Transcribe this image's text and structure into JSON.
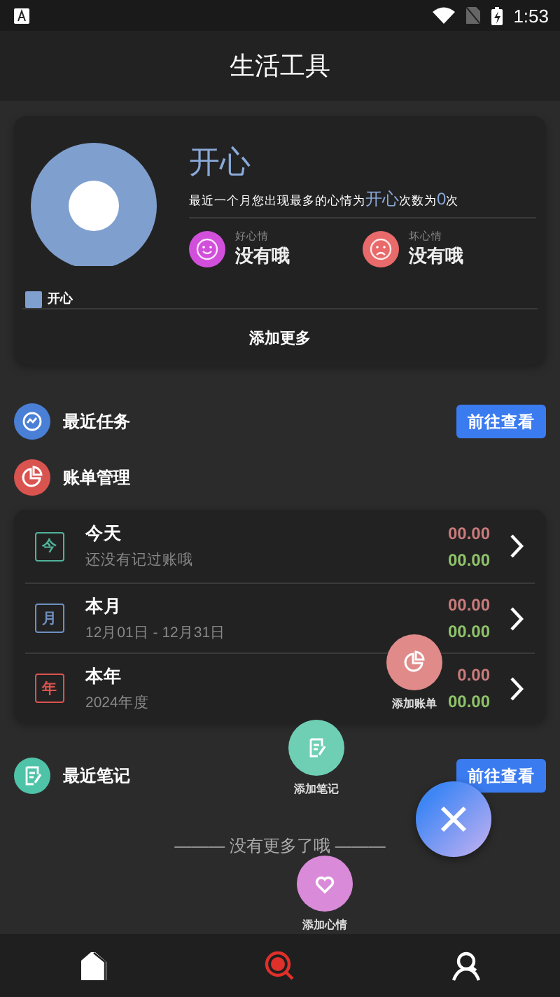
{
  "status_bar": {
    "time": "1:53"
  },
  "app_bar": {
    "title": "生活工具"
  },
  "mood_card": {
    "top_mood": "开心",
    "summary": {
      "prefix": "最近一个月您出现最多的心情为",
      "mood": "开心",
      "middle": "次数为",
      "count": "0",
      "suffix": "次"
    },
    "stats": [
      {
        "kind": "good",
        "label": "好心情",
        "value": "没有哦"
      },
      {
        "kind": "bad",
        "label": "坏心情",
        "value": "没有哦"
      }
    ],
    "legend": [
      {
        "label": "开心",
        "color": "#7f9fcf"
      }
    ],
    "add_more": "添加更多"
  },
  "sections": [
    {
      "kind": "tasks",
      "title": "最近任务",
      "button": "前往查看"
    },
    {
      "kind": "bills",
      "title": "账单管理",
      "rows": [
        {
          "kind": "day",
          "badge": "今",
          "title": "今天",
          "subtitle": "还没有记过账哦",
          "expense": "00.00",
          "income": "00.00"
        },
        {
          "kind": "month",
          "badge": "月",
          "title": "本月",
          "subtitle": "12月01日 - 12月31日",
          "expense": "00.00",
          "income": "00.00"
        },
        {
          "kind": "year",
          "badge": "年",
          "title": "本年",
          "subtitle": "2024年度",
          "expense": "0.00",
          "income": "00.00"
        }
      ]
    },
    {
      "kind": "notes",
      "title": "最近笔记",
      "button": "前往查看"
    }
  ],
  "end_note": "——— 没有更多了哦 ———",
  "fab_menu": [
    {
      "kind": "bill",
      "label": "添加账单"
    },
    {
      "kind": "note",
      "label": "添加笔记"
    },
    {
      "kind": "mood",
      "label": "添加心情"
    }
  ],
  "bottom_nav": [
    {
      "kind": "home",
      "selected": false
    },
    {
      "kind": "discover",
      "selected": true
    },
    {
      "kind": "profile",
      "selected": false
    }
  ]
}
